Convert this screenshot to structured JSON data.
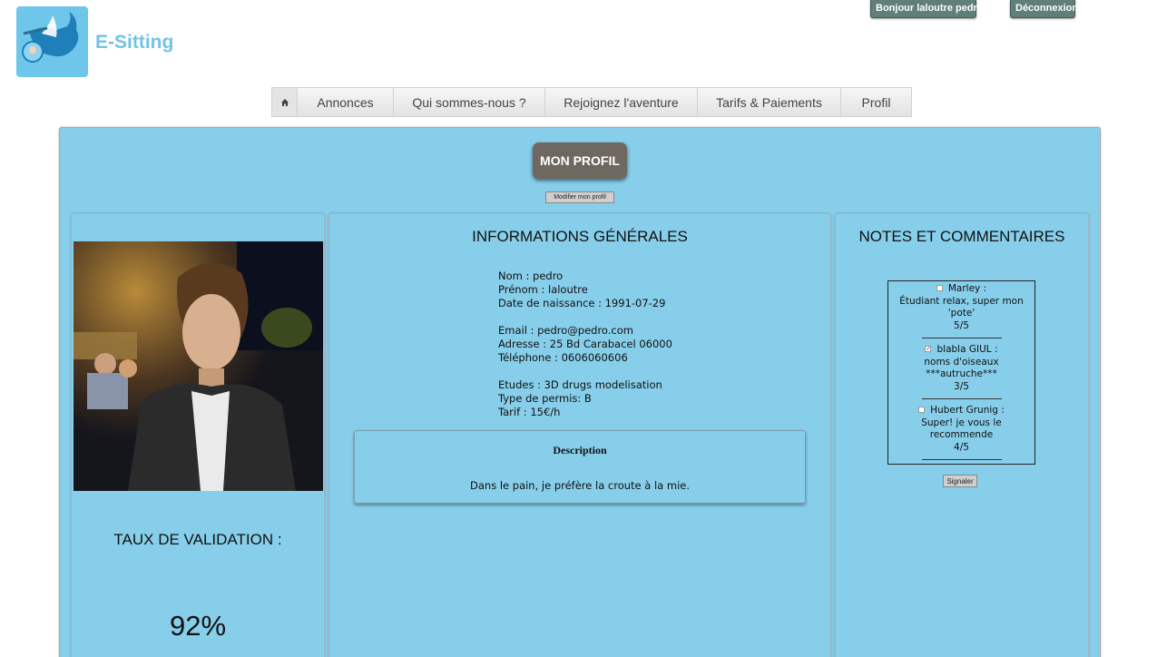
{
  "header": {
    "brand": "E-Sitting",
    "greeting_button": "Bonjour laloutre pedro",
    "logout_button": "Déconnexion"
  },
  "nav": {
    "items": [
      "Annonces",
      "Qui sommes-nous ?",
      "Rejoignez l'aventure",
      "Tarifs & Paiements",
      "Profil"
    ]
  },
  "profile": {
    "badge": "MON PROFIL",
    "edit_button": "Modifier mon profil",
    "validation_title": "TAUX DE VALIDATION :",
    "validation_value": "92%"
  },
  "info": {
    "title": "INFORMATIONS GÉNÉRALES",
    "nom": "Nom : pedro",
    "prenom": "Prénom : laloutre",
    "naissance": "Date de naissance : 1991-07-29",
    "email": "Email : pedro@pedro.com",
    "adresse": "Adresse : 25 Bd Carabacel 06000",
    "telephone": "Téléphone : 0606060606",
    "etudes": "Etudes : 3D drugs modelisation",
    "permis": "Type de permis: B",
    "tarif": "Tarif : 15€/h",
    "description_title": "Description",
    "description_text": "Dans le pain, je préfère la croute à la mie."
  },
  "notes": {
    "title": "NOTES ET COMMENTAIRES",
    "comments": [
      {
        "author": "Marley :",
        "text": "Étudiant relax, super mon 'pote'",
        "score": "5/5",
        "checked": false
      },
      {
        "author": "blabla GIUL :",
        "text": "noms d'oiseaux ***autruche***",
        "score": "3/5",
        "checked": true
      },
      {
        "author": "Hubert Grunig :",
        "text": "Super! je vous le recommende",
        "score": "4/5",
        "checked": false
      }
    ],
    "report_button": "Signaler"
  },
  "colors": {
    "panel": "#87ceea",
    "brand": "#72c4e4",
    "badge": "#6f6860",
    "top_buttons": "#5f7f78"
  }
}
